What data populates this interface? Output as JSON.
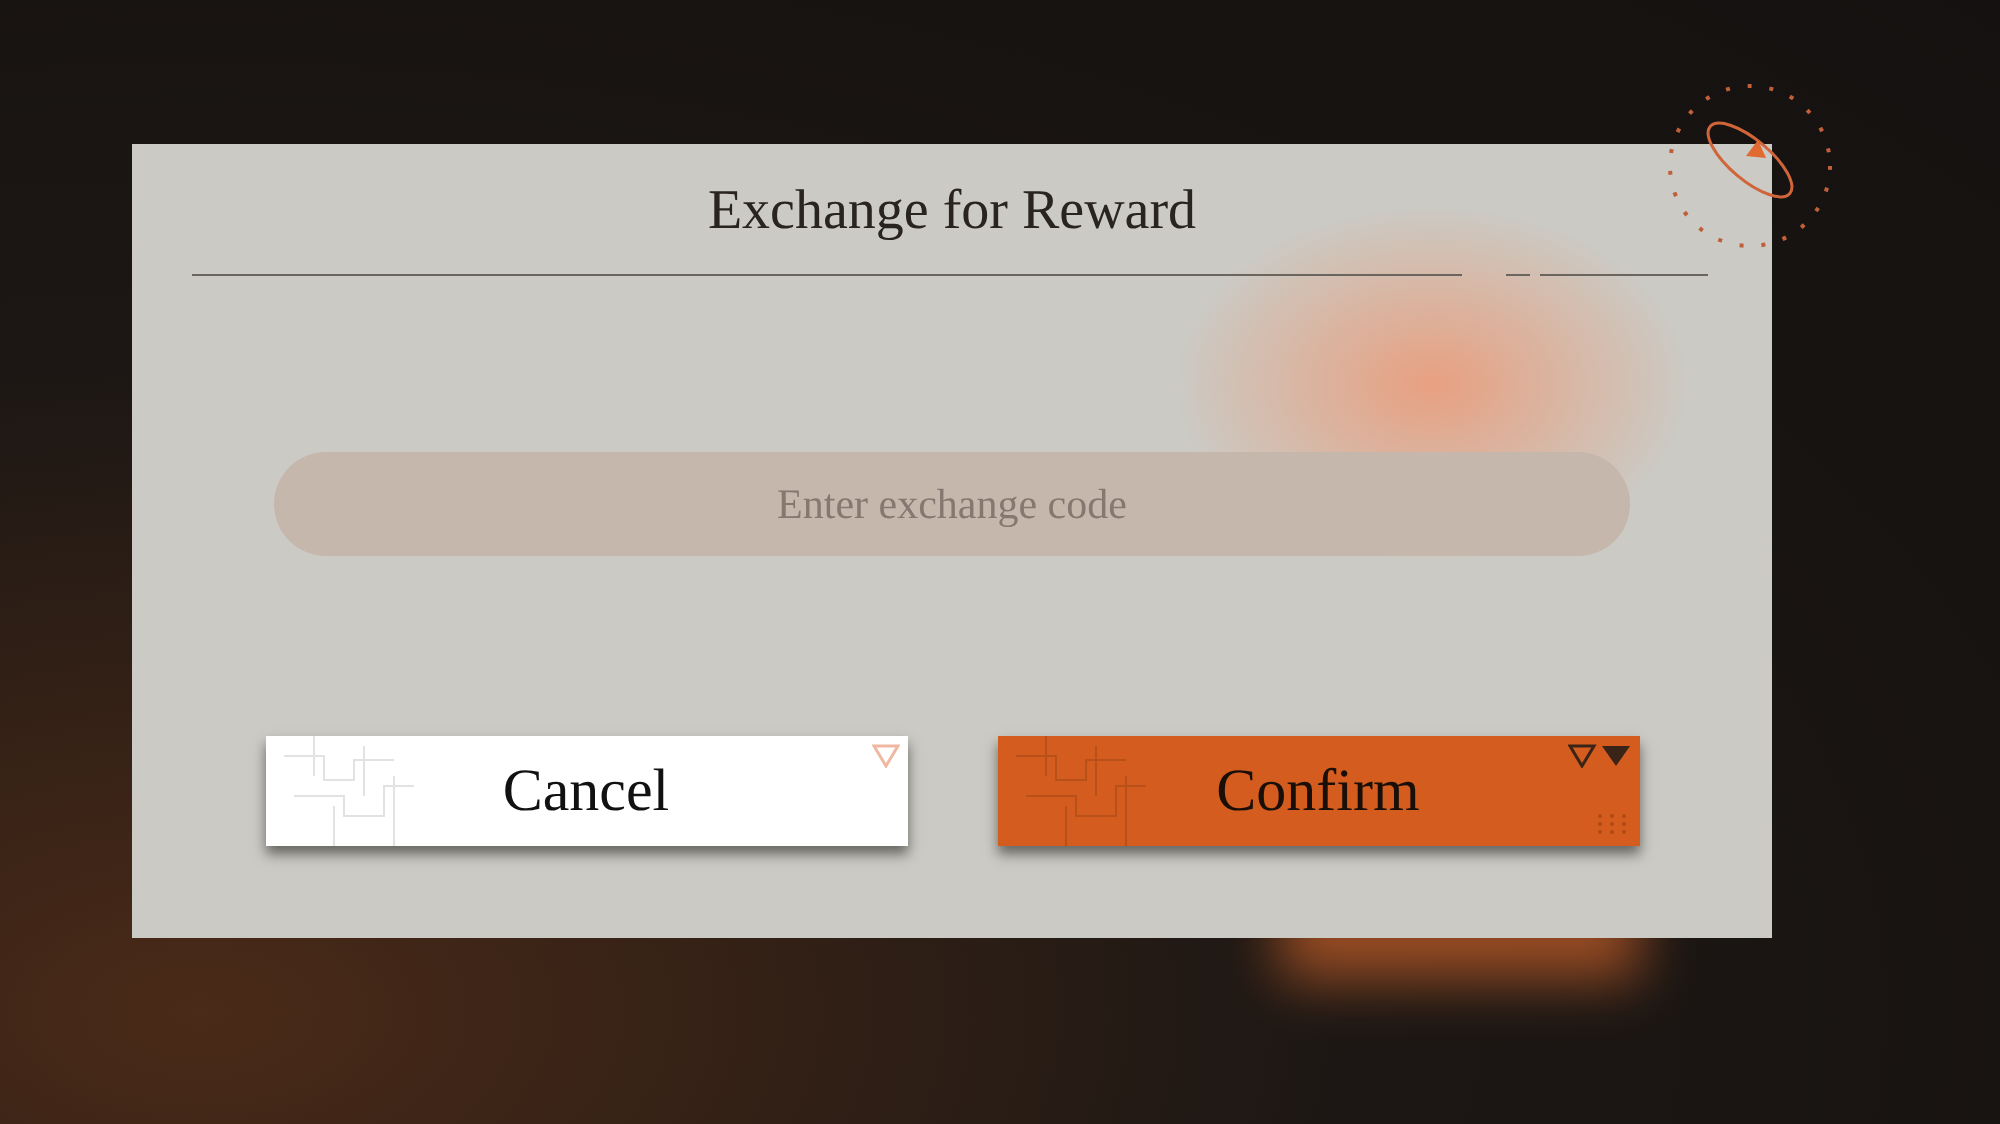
{
  "dialog": {
    "title": "Exchange for Reward",
    "code_field": {
      "placeholder": "Enter exchange code"
    },
    "buttons": [
      {
        "label": "Cancel",
        "kind": "cancel"
      },
      {
        "label": "Confirm",
        "kind": "confirm"
      }
    ]
  }
}
